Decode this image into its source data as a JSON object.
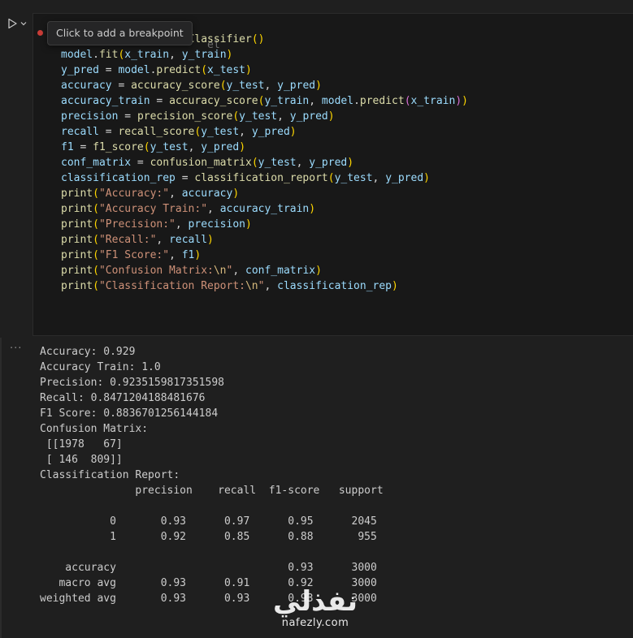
{
  "tooltip": "Click to add a breakpoint",
  "tooltip_hidden_tail": "el",
  "code_lines": [
    "model = RandomForestClassifier()",
    "model.fit(x_train, y_train)",
    "y_pred = model.predict(x_test)",
    "accuracy = accuracy_score(y_test, y_pred)",
    "accuracy_train = accuracy_score(y_train, model.predict(x_train))",
    "precision = precision_score(y_test, y_pred)",
    "recall = recall_score(y_test, y_pred)",
    "f1 = f1_score(y_test, y_pred)",
    "conf_matrix = confusion_matrix(y_test, y_pred)",
    "classification_rep = classification_report(y_test, y_pred)",
    "print(\"Accuracy:\", accuracy)",
    "print(\"Accuracy Train:\", accuracy_train)",
    "print(\"Precision:\", precision)",
    "print(\"Recall:\", recall)",
    "print(\"F1 Score:\", f1)",
    "print(\"Confusion Matrix:\\n\", conf_matrix)",
    "print(\"Classification Report:\\n\", classification_rep)"
  ],
  "output_menu": "···",
  "output_lines": [
    "Accuracy: 0.929",
    "Accuracy Train: 1.0",
    "Precision: 0.9235159817351598",
    "Recall: 0.8471204188481676",
    "F1 Score: 0.8836701256144184",
    "Confusion Matrix:",
    " [[1978   67]",
    " [ 146  809]]",
    "Classification Report:",
    "               precision    recall  f1-score   support",
    "",
    "           0       0.93      0.97      0.95      2045",
    "           1       0.92      0.85      0.88       955",
    "",
    "    accuracy                           0.93      3000",
    "   macro avg       0.93      0.91      0.92      3000",
    "weighted avg       0.93      0.93      0.93      3000"
  ],
  "watermark": {
    "arabic": "نفذلي",
    "latin": "nafezly.com"
  },
  "colors": {
    "background": "#1f1f1f",
    "cell_background": "#181818",
    "breakpoint": "#c93c37"
  }
}
